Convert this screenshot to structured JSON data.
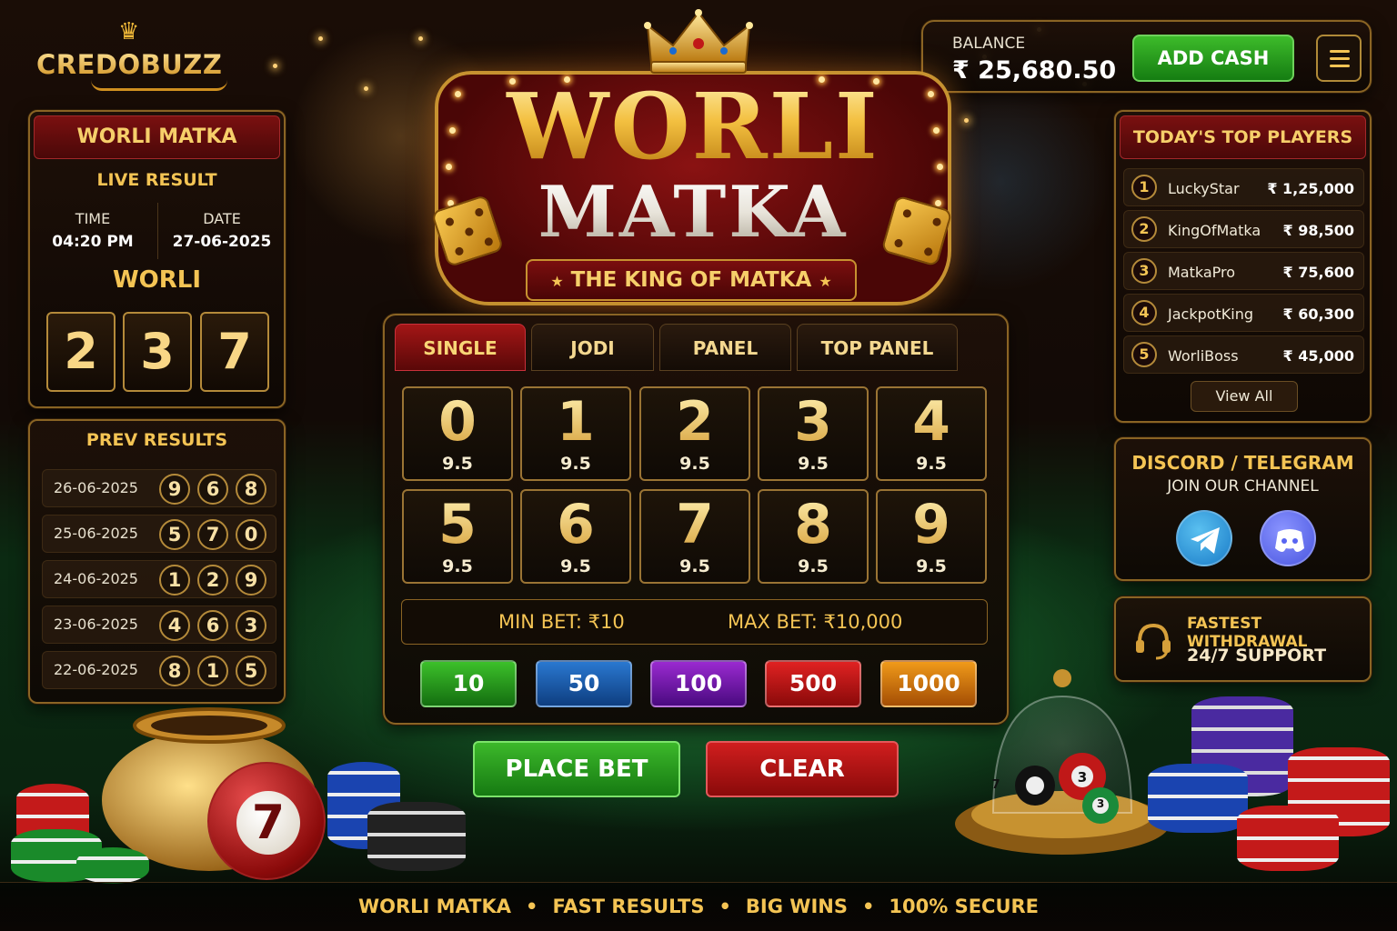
{
  "brand": {
    "name": "CREDOBUZZ"
  },
  "wallet": {
    "balance_label": "BALANCE",
    "balance_value": "₹ 25,680.50",
    "add_cash_label": "ADD CASH"
  },
  "live": {
    "title": "WORLI MATKA",
    "subtitle": "LIVE RESULT",
    "time_label": "TIME",
    "time_value": "04:20 PM",
    "date_label": "DATE",
    "date_value": "27-06-2025",
    "market": "WORLI",
    "digits": [
      "2",
      "3",
      "7"
    ]
  },
  "prev": {
    "title": "PREV RESULTS",
    "rows": [
      {
        "date": "26-06-2025",
        "digits": [
          "9",
          "6",
          "8"
        ]
      },
      {
        "date": "25-06-2025",
        "digits": [
          "5",
          "7",
          "0"
        ]
      },
      {
        "date": "24-06-2025",
        "digits": [
          "1",
          "2",
          "9"
        ]
      },
      {
        "date": "23-06-2025",
        "digits": [
          "4",
          "6",
          "3"
        ]
      },
      {
        "date": "22-06-2025",
        "digits": [
          "8",
          "1",
          "5"
        ]
      }
    ]
  },
  "hero": {
    "line1": "WORLI",
    "line2": "MATKA",
    "tagline": "THE KING OF MATKA"
  },
  "bet": {
    "tabs": [
      "SINGLE",
      "JODI",
      "PANEL",
      "TOP PANEL"
    ],
    "active_tab": "SINGLE",
    "numbers": [
      {
        "n": "0",
        "odds": "9.5"
      },
      {
        "n": "1",
        "odds": "9.5"
      },
      {
        "n": "2",
        "odds": "9.5"
      },
      {
        "n": "3",
        "odds": "9.5"
      },
      {
        "n": "4",
        "odds": "9.5"
      },
      {
        "n": "5",
        "odds": "9.5"
      },
      {
        "n": "6",
        "odds": "9.5"
      },
      {
        "n": "7",
        "odds": "9.5"
      },
      {
        "n": "8",
        "odds": "9.5"
      },
      {
        "n": "9",
        "odds": "9.5"
      }
    ],
    "min_bet": "MIN BET: ₹10",
    "max_bet": "MAX BET: ₹10,000",
    "chips": [
      {
        "label": "10",
        "color": "#1e9a1a"
      },
      {
        "label": "50",
        "color": "#1a5aa8"
      },
      {
        "label": "100",
        "color": "#6a1a9a"
      },
      {
        "label": "500",
        "color": "#b01414"
      },
      {
        "label": "1000",
        "color": "#c86a0a"
      }
    ],
    "place_label": "PLACE BET",
    "clear_label": "CLEAR"
  },
  "top_players": {
    "title": "TODAY'S TOP PLAYERS",
    "rows": [
      {
        "rank": "1",
        "name": "LuckyStar",
        "amount": "₹ 1,25,000"
      },
      {
        "rank": "2",
        "name": "KingOfMatka",
        "amount": "₹ 98,500"
      },
      {
        "rank": "3",
        "name": "MatkaPro",
        "amount": "₹ 75,600"
      },
      {
        "rank": "4",
        "name": "JackpotKing",
        "amount": "₹ 60,300"
      },
      {
        "rank": "5",
        "name": "WorliBoss",
        "amount": "₹ 45,000"
      }
    ],
    "view_all": "View All"
  },
  "social": {
    "title": "DISCORD / TELEGRAM",
    "subtitle": "JOIN OUR CHANNEL",
    "telegram_color": "#2a9ee0",
    "discord_color": "#5865f2"
  },
  "support": {
    "line1": "FASTEST WITHDRAWAL",
    "line2": "24/7 SUPPORT"
  },
  "decor": {
    "ball_number": "7",
    "dome_balls": [
      "7",
      "3",
      "3"
    ]
  },
  "footer": {
    "items": [
      "WORLI MATKA",
      "FAST RESULTS",
      "BIG WINS",
      "100% SECURE"
    ]
  }
}
